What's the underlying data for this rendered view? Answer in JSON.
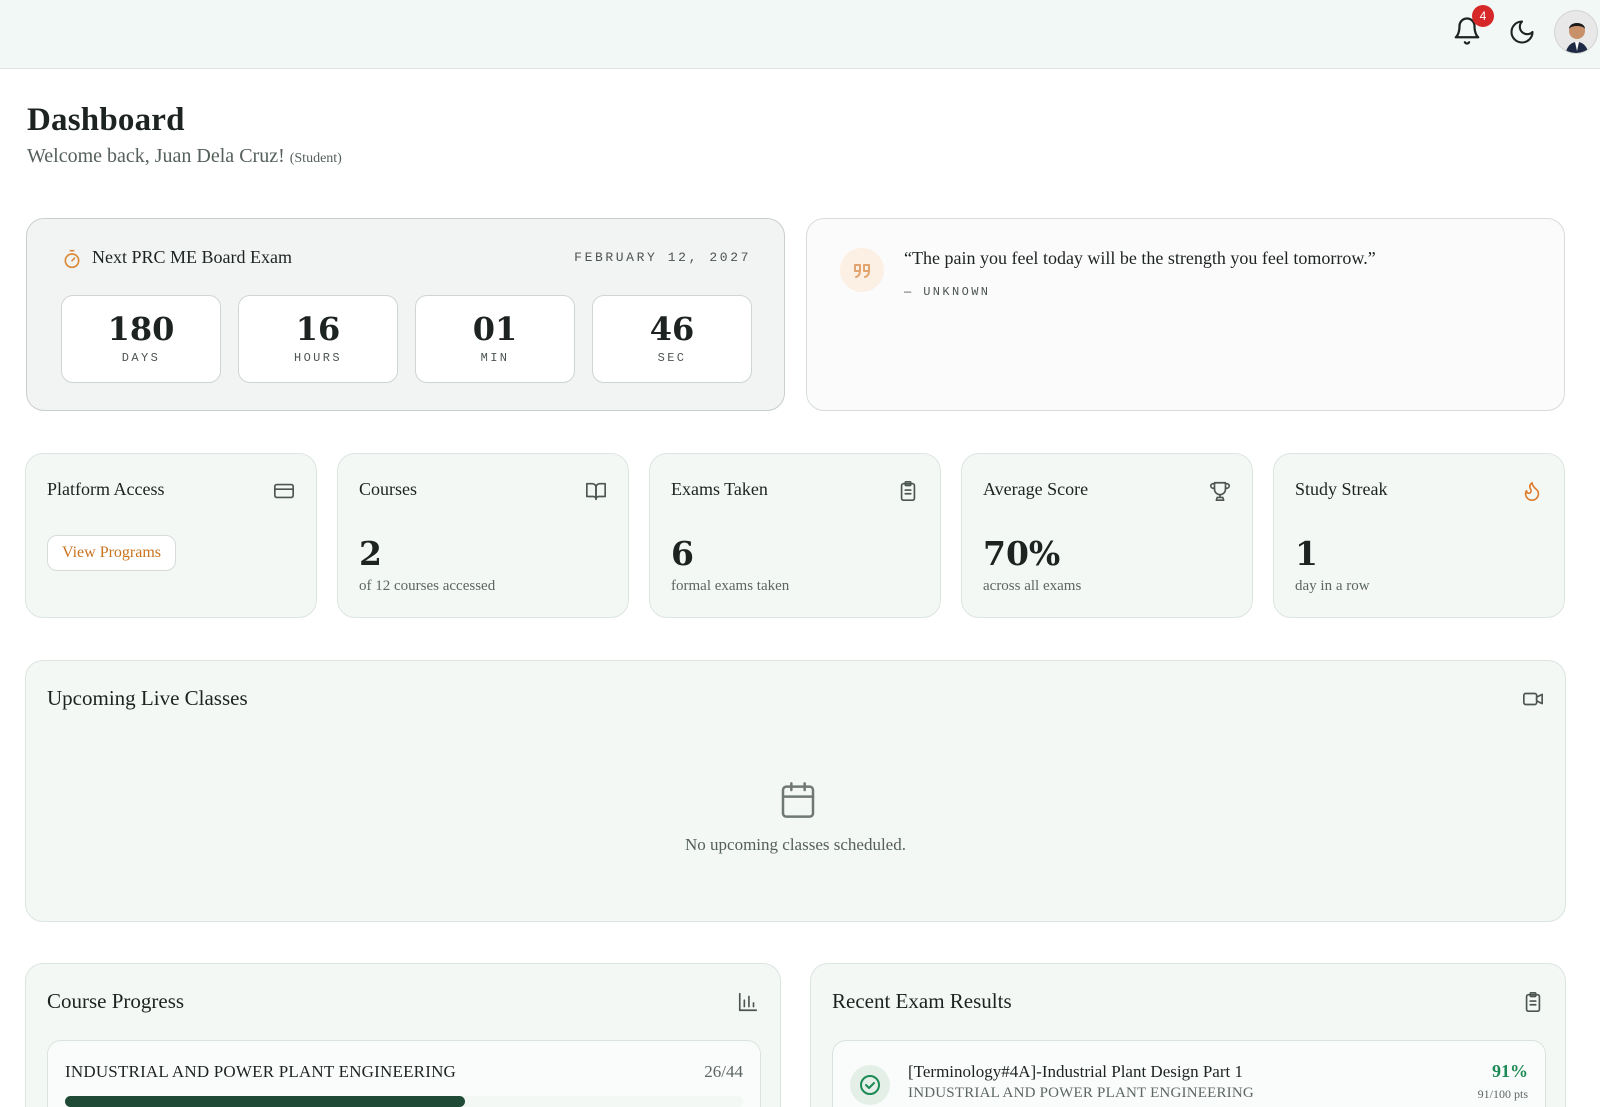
{
  "header": {
    "notification_count": "4",
    "icons": [
      "bell-icon",
      "moon-icon",
      "avatar"
    ]
  },
  "page": {
    "title": "Dashboard",
    "welcome": "Welcome back, Juan Dela Cruz!",
    "role": "(Student)"
  },
  "countdown": {
    "title": "Next PRC ME Board Exam",
    "date": "FEBRUARY 12, 2027",
    "units": [
      {
        "value": "180",
        "label": "DAYS"
      },
      {
        "value": "16",
        "label": "HOURS"
      },
      {
        "value": "01",
        "label": "MIN"
      },
      {
        "value": "46",
        "label": "SEC"
      }
    ]
  },
  "quote": {
    "text": "“The pain you feel today will be the strength you feel tomorrow.”",
    "author": "— UNKNOWN"
  },
  "stats": {
    "platform": {
      "label": "Platform Access",
      "button": "View Programs",
      "icon": "credit-card-icon"
    },
    "courses": {
      "label": "Courses",
      "value": "2",
      "sub": "of 12 courses accessed",
      "icon": "book-icon"
    },
    "exams": {
      "label": "Exams Taken",
      "value": "6",
      "sub": "formal exams taken",
      "icon": "clipboard-icon"
    },
    "average": {
      "label": "Average Score",
      "value": "70%",
      "sub": "across all exams",
      "icon": "trophy-icon"
    },
    "streak": {
      "label": "Study Streak",
      "value": "1",
      "sub": "day in a row",
      "icon": "flame-icon"
    }
  },
  "live_classes": {
    "title": "Upcoming Live Classes",
    "empty": "No upcoming classes scheduled.",
    "icon": "video-icon"
  },
  "course_progress": {
    "title": "Course Progress",
    "icon": "bar-chart-icon",
    "items": [
      {
        "name": "INDUSTRIAL AND POWER PLANT ENGINEERING",
        "count": "26/44",
        "progress": 0.59
      }
    ]
  },
  "recent_exams": {
    "title": "Recent Exam Results",
    "icon": "clipboard-icon",
    "items": [
      {
        "title": "[Terminology#4A]-Industrial Plant Design Part 1",
        "course": "INDUSTRIAL AND POWER PLANT ENGINEERING",
        "score": "91%",
        "points": "91/100 pts"
      }
    ]
  },
  "colors": {
    "accent_orange": "#c9731f",
    "progress_green": "#1f4a35",
    "score_green": "#1c8a55",
    "badge_red": "#d62828"
  }
}
